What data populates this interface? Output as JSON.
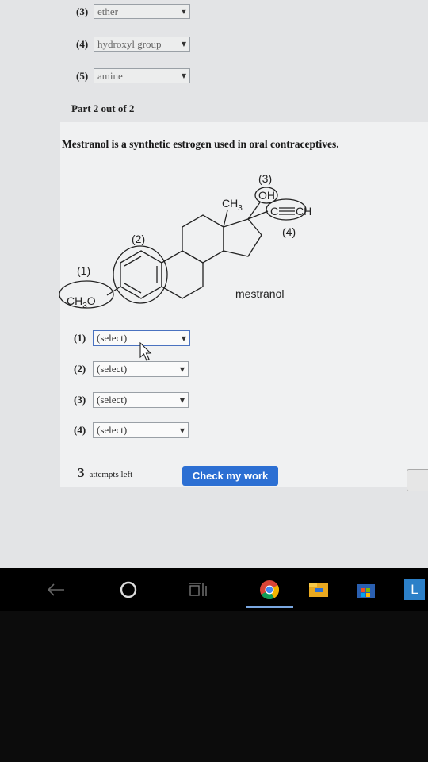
{
  "top_selects": [
    {
      "num": "(3)",
      "value": "ether"
    },
    {
      "num": "(4)",
      "value": "hydroxyl group"
    },
    {
      "num": "(5)",
      "value": "amine"
    }
  ],
  "part_label": "Part 2 out of 2",
  "question": "Mestranol is a synthetic estrogen used in oral contraceptives.",
  "molecule": {
    "name": "mestranol",
    "label1": "(1)",
    "label2": "(2)",
    "label3": "(3)",
    "label4": "(4)",
    "ch3_main": "CH",
    "ch3_sub": "3",
    "oh": "OH",
    "ch3o_a": "CH",
    "ch3o_sub": "3",
    "ch3o_b": "O",
    "alkyne_c": "C",
    "alkyne_ch": "CH"
  },
  "selects": [
    {
      "num": "(1)",
      "value": "(select)"
    },
    {
      "num": "(2)",
      "value": "(select)"
    },
    {
      "num": "(3)",
      "value": "(select)"
    },
    {
      "num": "(4)",
      "value": "(select)"
    }
  ],
  "select_arrow": "▼",
  "attempts": {
    "count": "3",
    "label": "attempts left"
  },
  "check_button": "Check my work",
  "taskbar": {
    "app_letter": "L"
  },
  "colors": {
    "accent": "#2c6fd3"
  }
}
